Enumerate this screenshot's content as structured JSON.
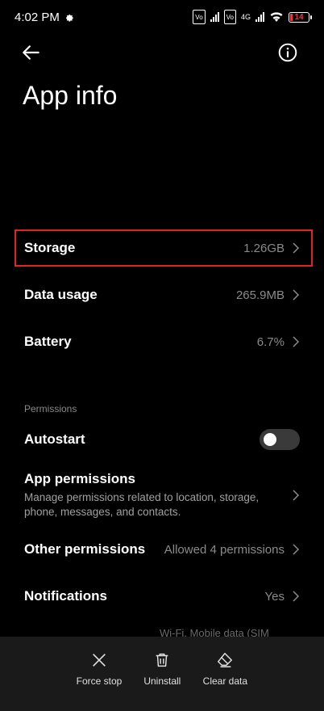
{
  "status_bar": {
    "time": "4:02 PM",
    "network": "4G",
    "battery_level": "14",
    "battery_percent_value": 0.14
  },
  "page": {
    "title": "App info"
  },
  "rows": {
    "storage": {
      "label": "Storage",
      "value": "1.26GB"
    },
    "data_usage": {
      "label": "Data usage",
      "value": "265.9MB"
    },
    "battery": {
      "label": "Battery",
      "value": "6.7%"
    },
    "permissions_header": "Permissions",
    "autostart": {
      "label": "Autostart",
      "enabled": false
    },
    "app_permissions": {
      "label": "App permissions",
      "description": "Manage permissions related to location, storage, phone, messages, and contacts."
    },
    "other_permissions": {
      "label": "Other permissions",
      "value": "Allowed 4 permissions"
    },
    "notifications": {
      "label": "Notifications",
      "value": "Yes"
    },
    "partial_text": "Wi-Fi, Mobile data (SIM"
  },
  "bottom_actions": [
    {
      "label": "Force stop",
      "icon": "close-icon"
    },
    {
      "label": "Uninstall",
      "icon": "trash-icon"
    },
    {
      "label": "Clear data",
      "icon": "eraser-icon"
    }
  ],
  "colors": {
    "background": "#000000",
    "highlight_border": "#e02424",
    "secondary_text": "#8a8a8a",
    "bottom_bar": "#1a1a1a"
  }
}
